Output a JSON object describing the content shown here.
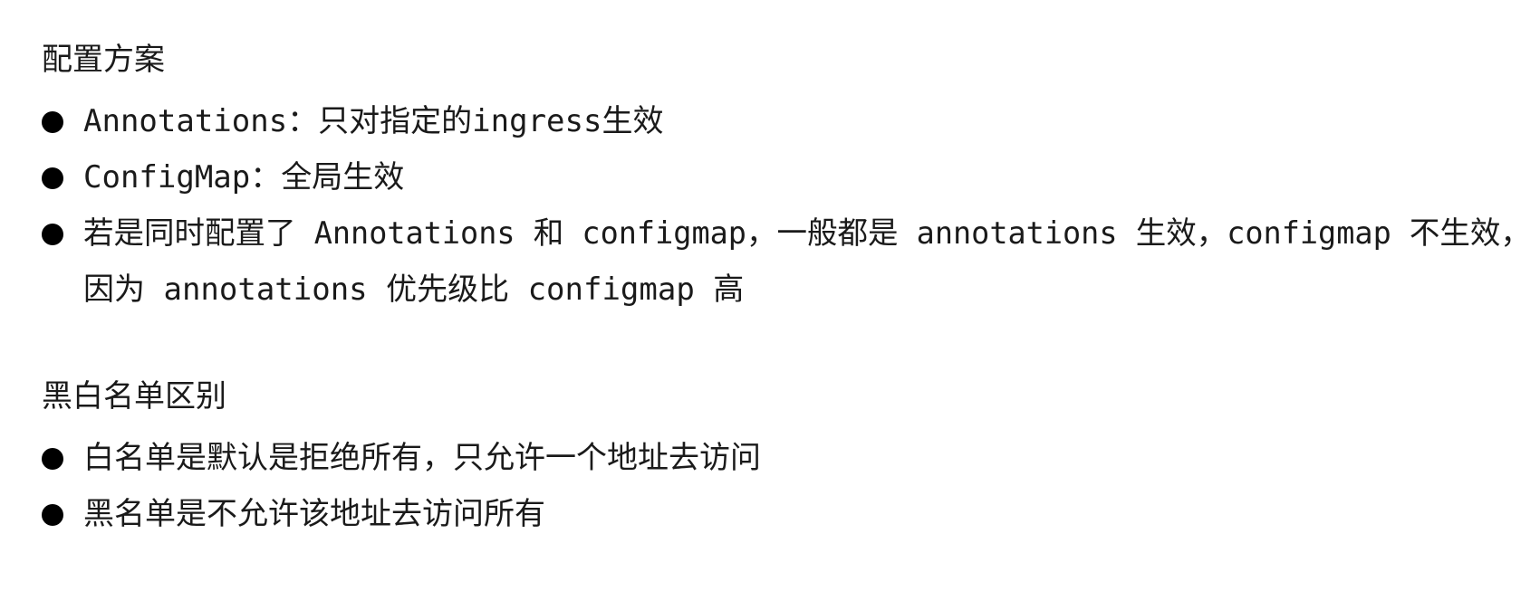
{
  "section1": {
    "heading": "配置方案",
    "items": [
      "Annotations：只对指定的ingress生效",
      "ConfigMap：全局生效",
      "若是同时配置了 Annotations 和 configmap，一般都是 annotations 生效，configmap 不生效，"
    ],
    "continuation": "因为 annotations 优先级比 configmap 高"
  },
  "section2": {
    "heading": "黑白名单区别",
    "items": [
      "白名单是默认是拒绝所有，只允许一个地址去访问",
      "黑名单是不允许该地址去访问所有"
    ]
  }
}
